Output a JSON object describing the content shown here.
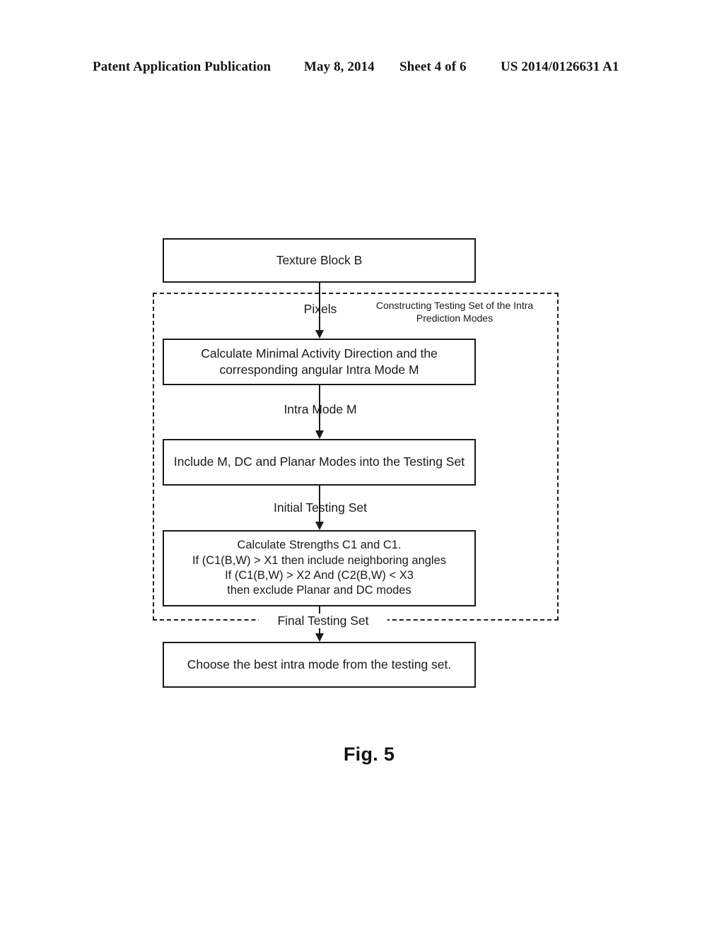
{
  "header": {
    "publication": "Patent Application Publication",
    "date": "May 8, 2014",
    "sheet": "Sheet 4 of 6",
    "doc_number": "US 2014/0126631 A1"
  },
  "figure": {
    "caption": "Fig. 5",
    "region_title": "Constructing Testing Set of the Intra Prediction Modes",
    "boxes": {
      "texture_block": "Texture Block B",
      "calculate_minimal": "Calculate Minimal Activity Direction and the corresponding angular Intra Mode M",
      "include_modes": "Include M, DC and Planar Modes into the Testing Set",
      "strengths_line1": "Calculate Strengths C1 and C1.",
      "strengths_line2": "If  (C1(B,W) > X1 then include neighboring angles",
      "strengths_line3": "If  (C1(B,W) > X2 And (C2(B,W) < X3",
      "strengths_line4": "then exclude Planar and DC modes",
      "choose_best": "Choose the best intra mode from the testing set."
    },
    "connectors": {
      "pixels": "Pixels",
      "intra_mode_m": "Intra Mode M",
      "initial_testing_set": "Initial Testing Set",
      "final_testing_set": "Final Testing Set"
    }
  },
  "colors": {
    "ink": "#1a1a1a",
    "paper": "#ffffff"
  }
}
